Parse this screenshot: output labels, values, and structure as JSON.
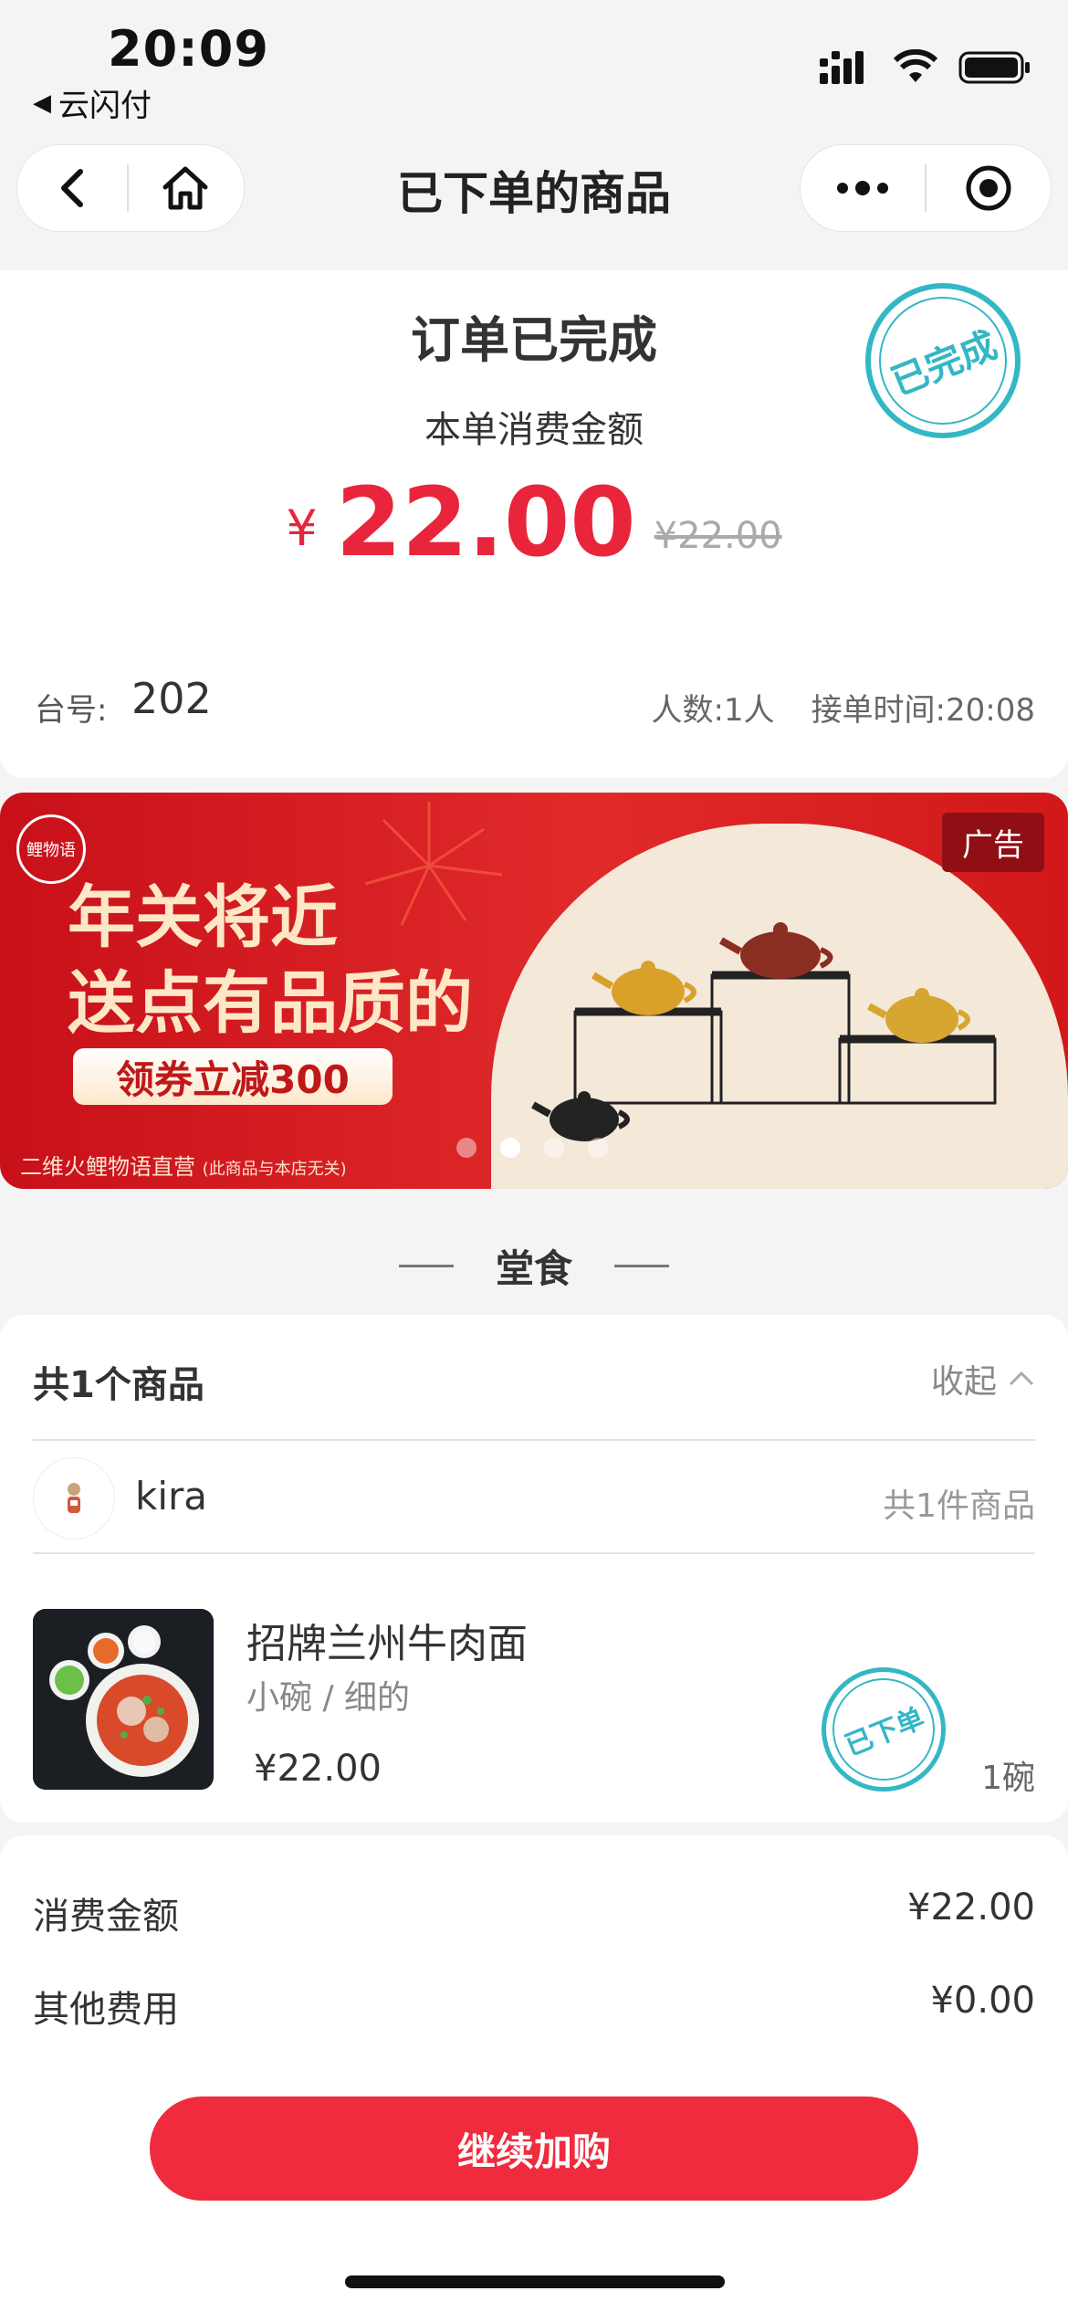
{
  "status_bar": {
    "time": "20:09",
    "back_app": "云闪付"
  },
  "nav": {
    "title": "已下单的商品"
  },
  "order": {
    "status_title": "订单已完成",
    "amount_label": "本单消费金额",
    "currency": "¥",
    "amount": "22.00",
    "original_amount": "¥22.00",
    "stamp_text": "已完成",
    "table_label": "台号:",
    "table_number": "202",
    "people": "人数:1人",
    "order_time": "接单时间:20:08"
  },
  "banner": {
    "ad_tag": "广告",
    "logo_text": "鲤物语",
    "headline_1": "年关将近",
    "headline_2": "送点有品质的",
    "coupon": "领券立减300",
    "footer": "二维火鲤物语直营",
    "footer_note": "(此商品与本店无关)",
    "dots": 4,
    "active_dot": 2
  },
  "section": {
    "title": "堂食"
  },
  "items": {
    "header": "共1个商品",
    "collapse_label": "收起",
    "user_name": "kira",
    "user_count": "共1件商品",
    "list": [
      {
        "name": "招牌兰州牛肉面",
        "spec": "小碗 / 细的",
        "price": "¥22.00",
        "qty": "1碗",
        "stamp_text": "已下单"
      }
    ]
  },
  "summary": {
    "rows": [
      {
        "label": "消费金额",
        "value": "¥22.00"
      },
      {
        "label": "其他费用",
        "value": "¥0.00"
      }
    ]
  },
  "cta": {
    "label": "继续加购"
  },
  "colors": {
    "accent": "#f02b3e",
    "stamp": "#34b7c4"
  }
}
